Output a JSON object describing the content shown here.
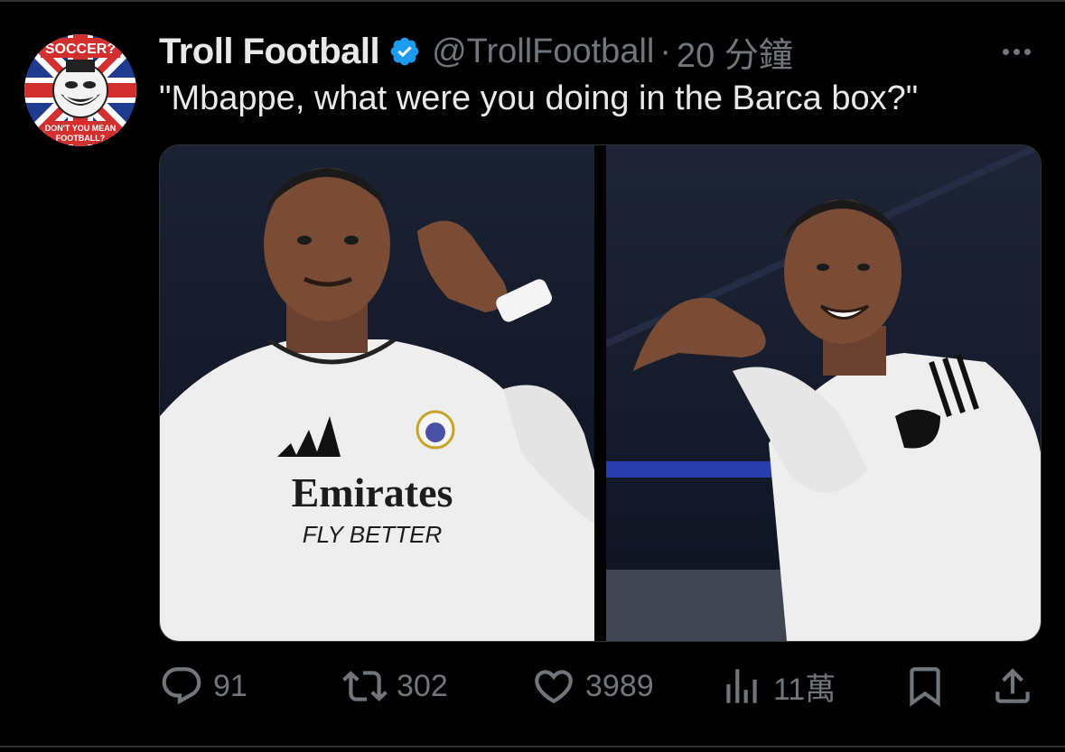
{
  "tweet": {
    "display_name": "Troll Football",
    "handle": "@TrollFootball",
    "separator": "·",
    "timestamp": "20 分鐘",
    "text": "\"Mbappe, what were you doing in the Barca box?\"",
    "avatar_text": {
      "top": "SOCCER?",
      "bottom_line1": "DON'T YOU MEAN",
      "bottom_line2": "FOOTBALL?"
    },
    "media": {
      "left_jersey_sponsor": "Emirates",
      "left_jersey_tagline": "FLY BETTER"
    }
  },
  "actions": {
    "reply_count": "91",
    "retweet_count": "302",
    "like_count": "3989",
    "views_count": "11萬"
  },
  "colors": {
    "background": "#000000",
    "text_primary": "#e7e9ea",
    "text_secondary": "#71767b",
    "verified": "#1d9bf0",
    "divider": "#2f3336"
  },
  "icons": {
    "more": "more-icon",
    "verified": "verified-badge-icon",
    "reply": "reply-icon",
    "retweet": "retweet-icon",
    "like": "heart-icon",
    "views": "views-chart-icon",
    "bookmark": "bookmark-icon",
    "share": "share-icon"
  }
}
